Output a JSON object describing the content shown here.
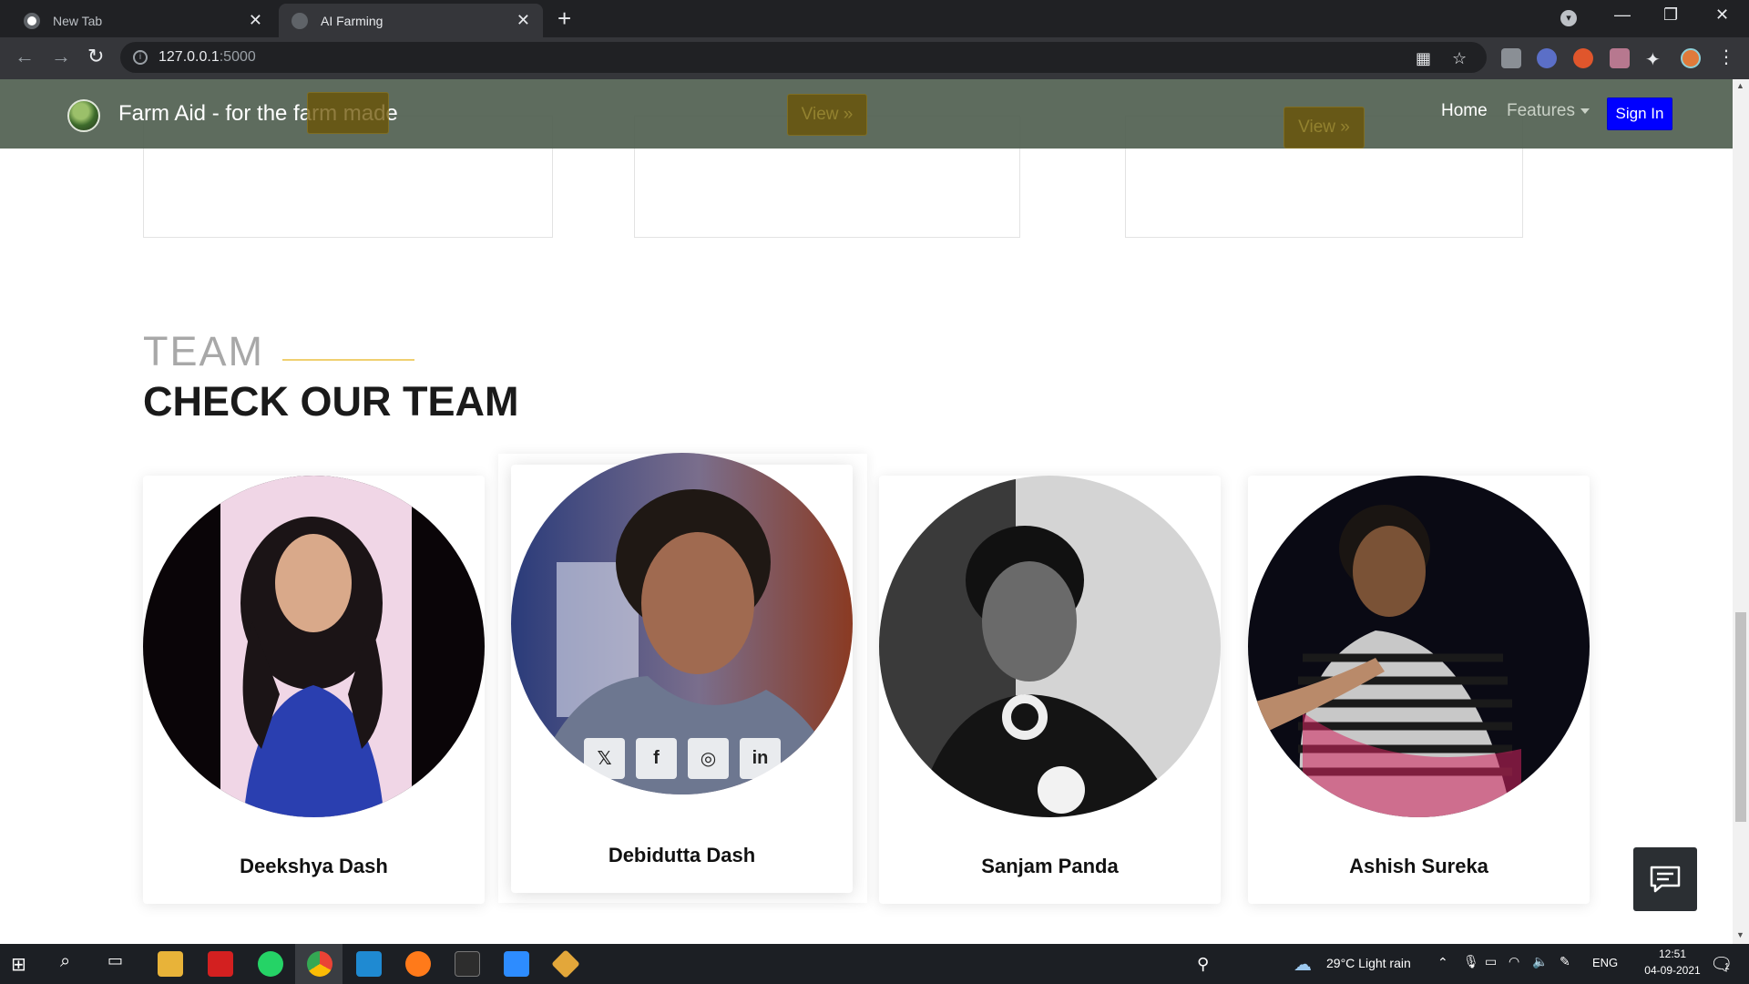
{
  "browser": {
    "tabs": [
      {
        "title": "New Tab",
        "active": false
      },
      {
        "title": "AI Farming",
        "active": true
      }
    ],
    "url_host": "127.0.0.1",
    "url_port": ":5000"
  },
  "site": {
    "brand": "Farm Aid - for the farm made",
    "nav": {
      "home": "Home",
      "features": "Features",
      "signin": "Sign In"
    },
    "prev_cards": {
      "view_labels": [
        "View »",
        "View »",
        "View »"
      ]
    },
    "team_section": {
      "label": "TEAM",
      "title": "CHECK OUR TEAM",
      "members": [
        {
          "name": "Deekshya Dash"
        },
        {
          "name": "Debidutta Dash",
          "socials": [
            "twitter-icon",
            "facebook-icon",
            "instagram-icon",
            "linkedin-icon"
          ]
        },
        {
          "name": "Sanjam Panda"
        },
        {
          "name": "Ashish Sureka"
        }
      ]
    }
  },
  "taskbar": {
    "weather": "29°C  Light rain",
    "language": "ENG",
    "time": "12:51",
    "date": "04-09-2021",
    "notifications": "1"
  },
  "colors": {
    "nav_bg": "#506050",
    "signin_bg": "#0000ff",
    "view_btn_bg": "#6b5200",
    "accent_line": "#f0d070"
  }
}
